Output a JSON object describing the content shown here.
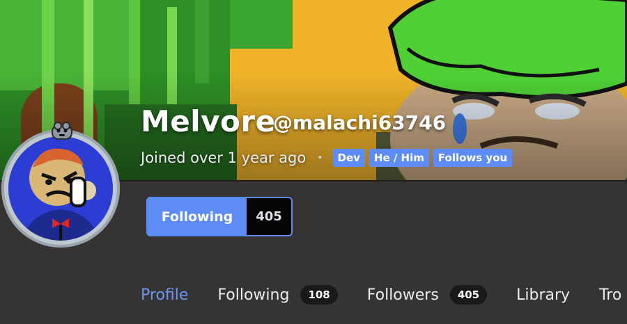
{
  "profile": {
    "display_name": "Melvore",
    "handle": "@malachi63746",
    "joined": "Joined over 1 year ago",
    "separator": "•",
    "tags": [
      "Dev",
      "He / Him",
      "Follows you"
    ]
  },
  "follow_button": {
    "label": "Following",
    "count": "405"
  },
  "tabs": [
    {
      "label": "Profile",
      "count": null
    },
    {
      "label": "Following",
      "count": "108"
    },
    {
      "label": "Followers",
      "count": "405"
    },
    {
      "label": "Library",
      "count": null
    },
    {
      "label": "Tro",
      "count": null
    }
  ],
  "colors": {
    "accent": "#5e8cf7",
    "active_tab": "#6e96f6",
    "background": "#363432"
  }
}
